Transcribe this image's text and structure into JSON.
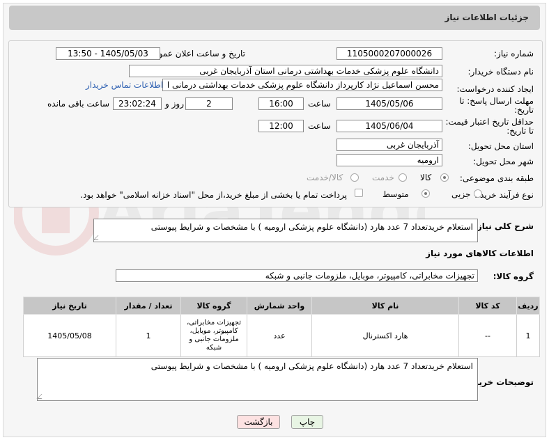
{
  "header": {
    "title": "جزئیات اطلاعات نیاز"
  },
  "form": {
    "need_number_label": "شماره نیاز:",
    "need_number": "1105000207000026",
    "announce_label": "تاریخ و ساعت اعلان عمومی:",
    "announce_value": "1405/05/03 - 13:50",
    "buyer_org_label": "نام دستگاه خریدار:",
    "buyer_org": "دانشگاه علوم پزشکی خدمات بهداشتی درمانی استان آذربایجان غربی",
    "requester_label": "ایجاد کننده درخواست:",
    "requester": "محسن اسماعیل نژاد کارپرداز دانشگاه علوم پزشکی خدمات بهداشتی درمانی ا",
    "contact_link": "اطلاعات تماس خریدار",
    "deadline_label_1": "مهلت ارسال پاسخ: تا",
    "deadline_label_2": "تاریخ:",
    "deadline_date": "1405/05/06",
    "time_label": "ساعت",
    "deadline_time": "16:00",
    "days_value": "2",
    "days_label": "روز و",
    "remaining_value": "23:02:24",
    "remaining_label": "ساعت باقی مانده",
    "validity_label_1": "حداقل تاریخ اعتبار قیمت:",
    "validity_label_2": "تا تاریخ:",
    "validity_date": "1405/06/04",
    "validity_time": "12:00",
    "province_label": "استان محل تحویل:",
    "province": "آذربایجان غربی",
    "city_label": "شهر محل تحویل:",
    "city": "ارومیه",
    "category_label": "طبقه بندی موضوعی:",
    "category_options": [
      "کالا",
      "خدمت",
      "کالا/خدمت"
    ],
    "category_selected": "کالا",
    "process_label": "نوع فرآیند خرید :",
    "process_options": [
      "جزیی",
      "متوسط"
    ],
    "process_selected": "متوسط",
    "payment_note": "پرداخت تمام یا بخشی از مبلغ خرید،از محل \"اسناد خزانه اسلامی\" خواهد بود."
  },
  "description": {
    "label": "شرح کلی نیاز:",
    "text": "استعلام خریدتعداد 7 عدد هارد (دانشگاه علوم پزشکی ارومیه ) با مشخصات و شرایط  پیوستی"
  },
  "goods": {
    "section_title": "اطلاعات کالاهای مورد نیاز",
    "group_label": "گروه کالا:",
    "group_value": "تجهیزات مخابراتی، کامپیوتر، موبایل، ملزومات جانبی و شبکه",
    "columns": [
      "ردیف",
      "کد کالا",
      "نام کالا",
      "واحد شمارش",
      "گروه کالا",
      "تعداد / مقدار",
      "تاریخ نیاز"
    ],
    "rows": [
      {
        "row": "1",
        "code": "--",
        "name": "هارد اکسترنال",
        "unit": "عدد",
        "group": "تجهیزات مخابراتی، کامپیوتر، موبایل، ملزومات جانبی و شبکه",
        "qty": "1",
        "date": "1405/05/08"
      }
    ]
  },
  "buyer_notes": {
    "label": "توضیحات خریدار:",
    "text": "استعلام خریدتعداد 7 عدد هارد (دانشگاه علوم پزشکی ارومیه ) با مشخصات و شرایط  پیوستی"
  },
  "buttons": {
    "print": "چاپ",
    "back": "بازگشت"
  },
  "colors": {
    "header_bg": "#c8c8c8",
    "back_button_bg": "#fde2e2",
    "print_button_bg": "#e8f5e4",
    "link": "#2a5db0"
  }
}
